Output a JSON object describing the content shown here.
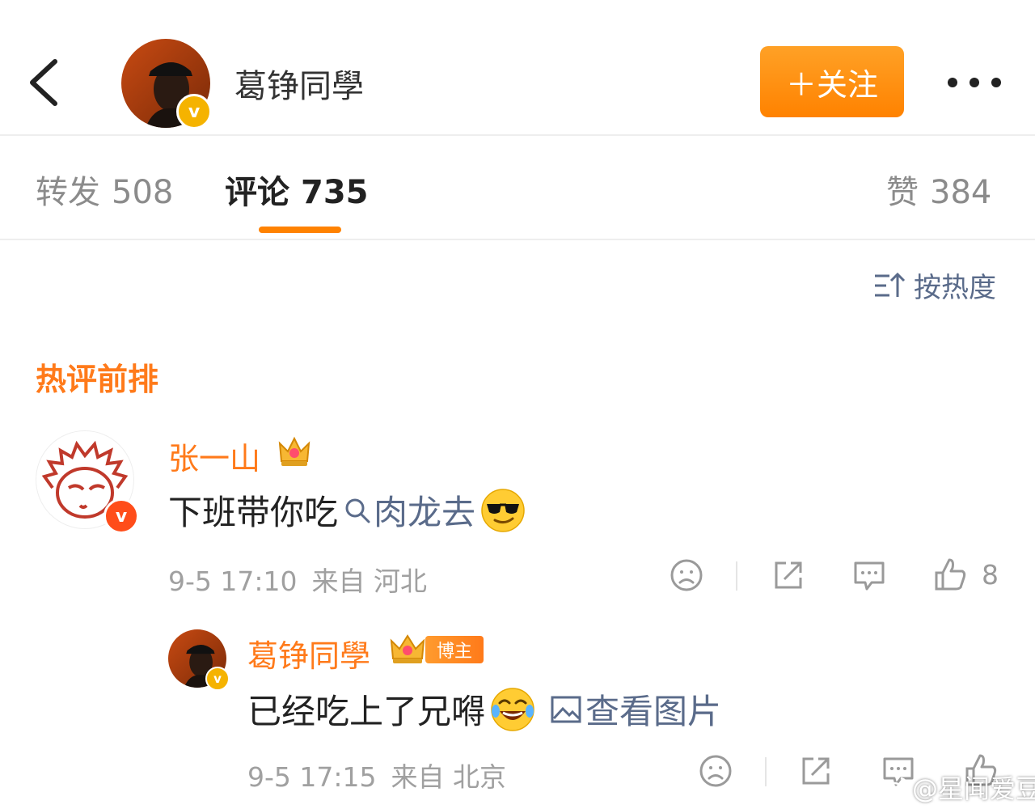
{
  "header": {
    "username": "葛铮同學",
    "follow_label": "＋关注",
    "more_label": "•••"
  },
  "tabs": [
    {
      "label": "转发",
      "count": "508"
    },
    {
      "label": "评论",
      "count": "735",
      "active": true
    },
    {
      "label": "赞",
      "count": "384"
    }
  ],
  "sort": {
    "label": "按热度"
  },
  "section_title": "热评前排",
  "comment": {
    "username": "张一山",
    "text_before": "下班带你吃",
    "link_text": "肉龙去",
    "emoji": "sunglasses-emoji",
    "time": "9-5 17:10",
    "location": "来自 河北",
    "likes": "8"
  },
  "reply": {
    "username": "葛铮同學",
    "badge": "博主",
    "text": "已经吃上了兄嘚",
    "emoji": "laugh-tears-emoji",
    "image_link": "查看图片",
    "time": "9-5 17:15",
    "location": "来自 北京"
  },
  "watermark": "@星闻爱豆",
  "colors": {
    "accent": "#ff8200",
    "link": "#5a6b8a",
    "name": "#ff7a1a",
    "verified": "#f5b300"
  }
}
